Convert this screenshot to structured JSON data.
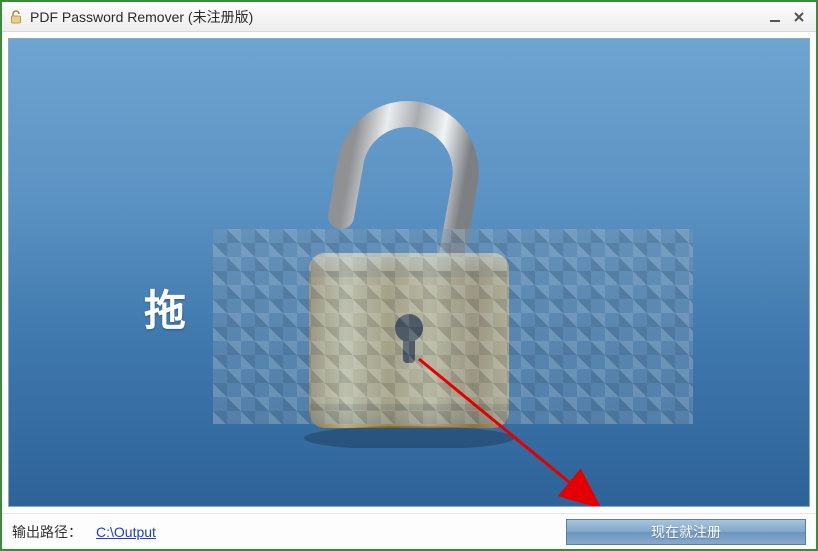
{
  "window": {
    "title": "PDF Password Remover (未注册版)"
  },
  "dropzone": {
    "drag_text_visible_prefix": "拖"
  },
  "footer": {
    "output_label": "输出路径：",
    "output_path": "C:\\Output",
    "register_label": "现在就注册"
  },
  "icons": {
    "app": "padlock-icon",
    "minimize": "minimize-icon",
    "close": "close-icon"
  }
}
